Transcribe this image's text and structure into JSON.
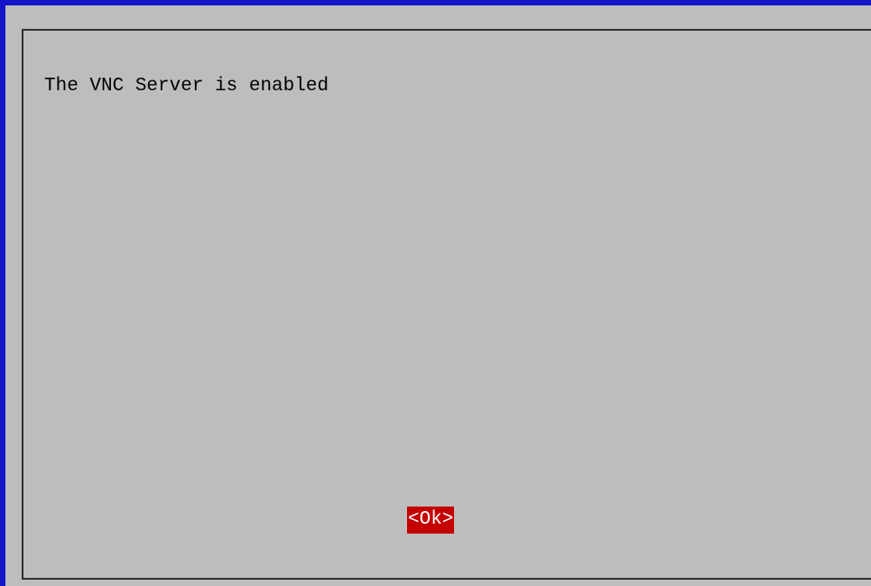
{
  "dialog": {
    "message": "The VNC Server is enabled",
    "ok_label": "<Ok>"
  },
  "colors": {
    "terminal_border": "#1515c8",
    "background": "#bdbdbd",
    "button_highlight": "#c40000"
  }
}
